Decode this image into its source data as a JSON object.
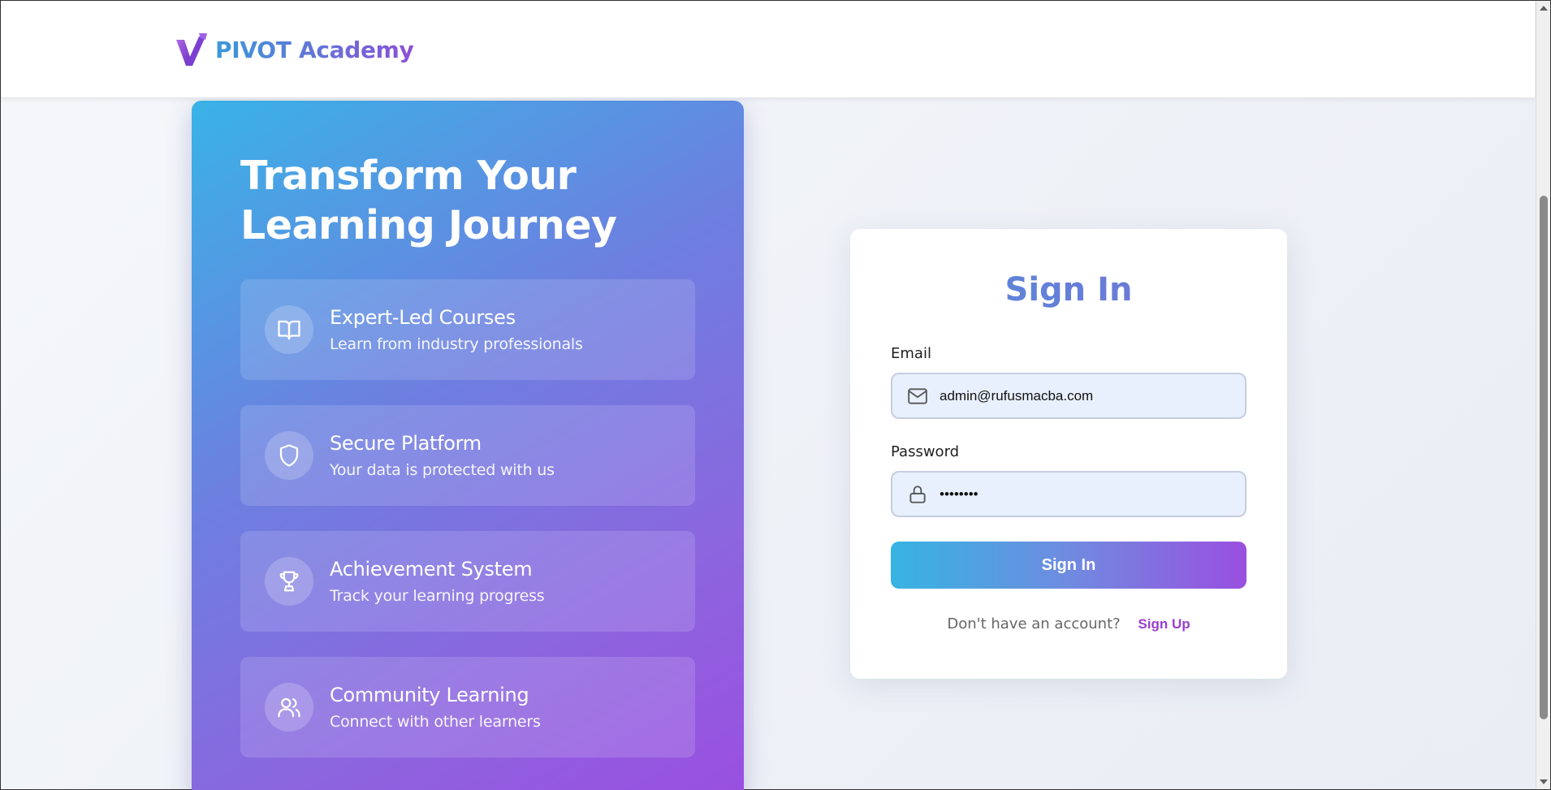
{
  "header": {
    "brand_name": "PIVOT Academy",
    "logo_icon": "v-logo-icon"
  },
  "hero": {
    "title": "Transform Your\nLearning Journey",
    "features": [
      {
        "icon": "book-open-icon",
        "title": "Expert-Led Courses",
        "description": "Learn from industry professionals"
      },
      {
        "icon": "shield-icon",
        "title": "Secure Platform",
        "description": "Your data is protected with us"
      },
      {
        "icon": "trophy-icon",
        "title": "Achievement System",
        "description": "Track your learning progress"
      },
      {
        "icon": "users-icon",
        "title": "Community Learning",
        "description": "Connect with other learners"
      }
    ]
  },
  "signin": {
    "title": "Sign In",
    "email_label": "Email",
    "email_value": "admin@rufusmacba.com",
    "password_label": "Password",
    "password_value": "••••••••",
    "submit_label": "Sign In",
    "no_account_text": "Don't have an account?",
    "signup_label": "Sign Up"
  },
  "colors": {
    "gradient_start": "#36b4e2",
    "gradient_end": "#9a4fe0",
    "link": "#9a3fcf",
    "input_bg": "#e8f0fd"
  }
}
